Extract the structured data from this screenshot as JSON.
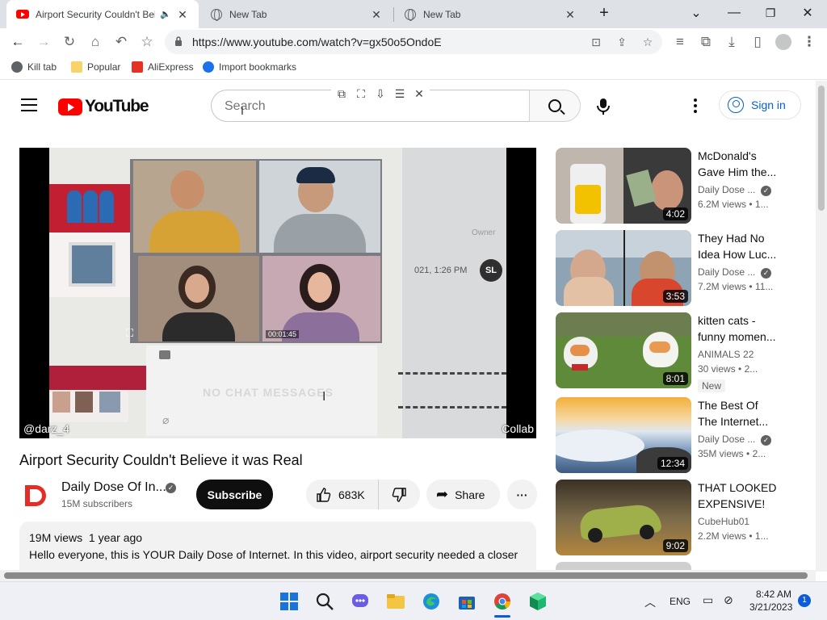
{
  "browser": {
    "tabs": [
      {
        "title": "Airport Security Couldn't Bel",
        "favicon": "youtube-icon",
        "active": true
      },
      {
        "title": "New Tab",
        "favicon": "globe-icon",
        "active": false
      },
      {
        "title": "New Tab",
        "favicon": "globe-icon",
        "active": false
      }
    ],
    "new_tab": "+",
    "window_controls": {
      "minimize": "—",
      "restore": "❐",
      "close": "✕",
      "tab_search": "⌄"
    },
    "url": "https://www.youtube.com/watch?v=gx50o5OndoE",
    "bookmarks": [
      {
        "label": "Kill tab",
        "icon": "kill-tab-icon"
      },
      {
        "label": "Popular",
        "icon": "folder-icon"
      },
      {
        "label": "AliExpress",
        "icon": "aliexpress-icon"
      },
      {
        "label": "Import bookmarks",
        "icon": "gear-icon"
      }
    ]
  },
  "youtube": {
    "logo_text": "YouTube",
    "search_placeholder": "Search",
    "signin_label": "Sign in",
    "video": {
      "overlay_user": "@darz_4",
      "overlay_collab": "Collab",
      "inner_timestamp": "021, 1:26 PM",
      "inner_owner": "Owner",
      "inner_avatar": "SL",
      "inner_timer": "00:01:45",
      "inner_no_chat": "NO CHAT MESSAGES",
      "title": "Airport Security Couldn't Believe it was Real"
    },
    "channel": {
      "name": "Daily Dose Of In...",
      "subscribers": "15M subscribers",
      "subscribe_label": "Subscribe"
    },
    "actions": {
      "likes": "683K",
      "share_label": "Share"
    },
    "description": {
      "views": "19M views",
      "age": "1 year ago",
      "text": "Hello everyone, this is YOUR Daily Dose of Internet. In this video, airport security needed a closer"
    },
    "recommendations": [
      {
        "title": "McDonald's Gave Him the...",
        "channel": "Daily Dose ...",
        "verified": true,
        "views": "6.2M views",
        "age": "1...",
        "duration": "4:02",
        "badge": ""
      },
      {
        "title": "They Had No Idea How Luc...",
        "channel": "Daily Dose ...",
        "verified": true,
        "views": "7.2M views",
        "age": "11...",
        "duration": "3:53",
        "badge": ""
      },
      {
        "title": "kitten cats - funny momen...",
        "channel": "ANIMALS 22",
        "verified": false,
        "views": "30 views",
        "age": "2...",
        "duration": "8:01",
        "badge": "New"
      },
      {
        "title": "The Best Of The Internet...",
        "channel": "Daily Dose ...",
        "verified": true,
        "views": "35M views",
        "age": "2...",
        "duration": "12:34",
        "badge": ""
      },
      {
        "title": "THAT LOOKED EXPENSIVE!",
        "channel": "CubeHub01",
        "verified": false,
        "views": "2.2M views",
        "age": "1...",
        "duration": "9:02",
        "badge": ""
      }
    ]
  },
  "taskbar": {
    "language": "ENG",
    "time": "8:42 AM",
    "date": "3/21/2023",
    "notifications": "1"
  },
  "colors": {
    "youtube_red": "#ff0000",
    "link_blue": "#065fd4",
    "tabstrip": "#dee1e6"
  }
}
